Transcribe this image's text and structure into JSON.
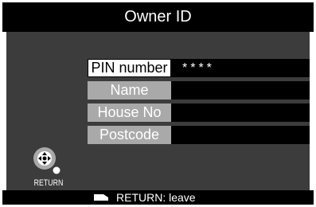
{
  "title": "Owner ID",
  "fields": [
    {
      "label": "PIN number",
      "value": "****"
    },
    {
      "label": "Name",
      "value": ""
    },
    {
      "label": "House No",
      "value": ""
    },
    {
      "label": "Postcode",
      "value": ""
    }
  ],
  "nav": {
    "icon": "dpad-navigation-icon",
    "caption": "RETURN"
  },
  "footer": {
    "icon": "return-key-icon",
    "hint": "RETURN: leave"
  },
  "colors": {
    "panel": "#3c3c3c",
    "bar": "#000000",
    "label": "#a9a9a9",
    "label_active": "#ffffff"
  }
}
